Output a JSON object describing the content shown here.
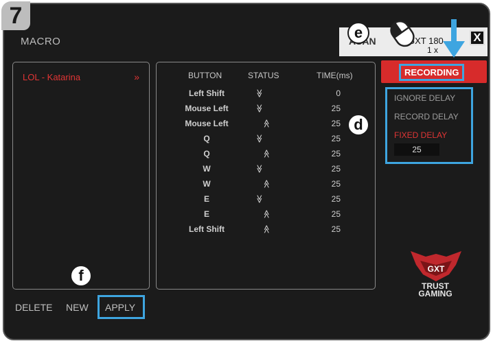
{
  "step_badge": "7",
  "title": "MACRO",
  "macro_list": [
    {
      "label": "LOL - Katarina",
      "chevron": "»"
    }
  ],
  "table": {
    "headers": [
      "BUTTON",
      "STATUS",
      "TIME(ms)"
    ],
    "rows": [
      {
        "button": "Left Shift",
        "status": "down",
        "glyph": "≫",
        "time": "0"
      },
      {
        "button": "Mouse Left",
        "status": "down",
        "glyph": "≫",
        "time": "25"
      },
      {
        "button": "Mouse Left",
        "status": "up",
        "glyph": "≫",
        "time": "25"
      },
      {
        "button": "Q",
        "status": "down",
        "glyph": "≫",
        "time": "25"
      },
      {
        "button": "Q",
        "status": "up",
        "glyph": "≫",
        "time": "25"
      },
      {
        "button": "W",
        "status": "down",
        "glyph": "≫",
        "time": "25"
      },
      {
        "button": "W",
        "status": "up",
        "glyph": "≫",
        "time": "25"
      },
      {
        "button": "E",
        "status": "down",
        "glyph": "≫",
        "time": "25"
      },
      {
        "button": "E",
        "status": "up",
        "glyph": "≫",
        "time": "25"
      },
      {
        "button": "Left Shift",
        "status": "up",
        "glyph": "≫",
        "time": "25"
      }
    ]
  },
  "device": {
    "name": "ASAN",
    "model": "GXT 180",
    "count": "1 x"
  },
  "close_label": "X",
  "record_label": "RECORDING",
  "delay_options": [
    {
      "label": "IGNORE DELAY",
      "active": false
    },
    {
      "label": "RECORD DELAY",
      "active": false
    },
    {
      "label": "FIXED DELAY",
      "active": true
    }
  ],
  "fixed_delay_value": "25",
  "footer": {
    "delete": "DELETE",
    "new": "NEW",
    "apply": "APPLY"
  },
  "callouts": {
    "e": "e",
    "d": "d",
    "f": "f"
  },
  "logo_text": {
    "line1": "TRUST",
    "line2": "GAMING"
  },
  "colors": {
    "accent_red": "#d72b2b",
    "highlight_blue": "#3ea5e0",
    "background": "#1b1b1b"
  }
}
